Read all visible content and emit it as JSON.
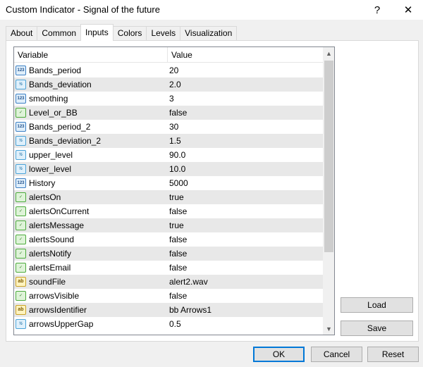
{
  "window": {
    "title": "Custom Indicator - Signal of the future",
    "help_glyph": "?",
    "close_glyph": "✕"
  },
  "tabs": [
    {
      "label": "About"
    },
    {
      "label": "Common"
    },
    {
      "label": "Inputs"
    },
    {
      "label": "Colors"
    },
    {
      "label": "Levels"
    },
    {
      "label": "Visualization"
    }
  ],
  "active_tab": "Inputs",
  "table": {
    "headers": {
      "variable": "Variable",
      "value": "Value"
    },
    "rows": [
      {
        "icon": "int-icon",
        "icon_text": "123",
        "name": "Bands_period",
        "value": "20"
      },
      {
        "icon": "double-icon",
        "icon_text": "½",
        "name": "Bands_deviation",
        "value": "2.0"
      },
      {
        "icon": "int-icon",
        "icon_text": "123",
        "name": "smoothing",
        "value": "3"
      },
      {
        "icon": "bool-icon",
        "icon_text": "✓",
        "name": "Level_or_BB",
        "value": "false"
      },
      {
        "icon": "int-icon",
        "icon_text": "123",
        "name": "Bands_period_2",
        "value": "30"
      },
      {
        "icon": "double-icon",
        "icon_text": "½",
        "name": "Bands_deviation_2",
        "value": "1.5"
      },
      {
        "icon": "double-icon",
        "icon_text": "½",
        "name": "upper_level",
        "value": "90.0"
      },
      {
        "icon": "double-icon",
        "icon_text": "½",
        "name": "lower_level",
        "value": "10.0"
      },
      {
        "icon": "int-icon",
        "icon_text": "123",
        "name": "History",
        "value": "5000"
      },
      {
        "icon": "bool-icon",
        "icon_text": "✓",
        "name": "alertsOn",
        "value": "true"
      },
      {
        "icon": "bool-icon",
        "icon_text": "✓",
        "name": "alertsOnCurrent",
        "value": "false"
      },
      {
        "icon": "bool-icon",
        "icon_text": "✓",
        "name": "alertsMessage",
        "value": "true"
      },
      {
        "icon": "bool-icon",
        "icon_text": "✓",
        "name": "alertsSound",
        "value": "false"
      },
      {
        "icon": "bool-icon",
        "icon_text": "✓",
        "name": "alertsNotify",
        "value": "false"
      },
      {
        "icon": "bool-icon",
        "icon_text": "✓",
        "name": "alertsEmail",
        "value": "false"
      },
      {
        "icon": "string-icon",
        "icon_text": "ab",
        "name": "soundFile",
        "value": "alert2.wav"
      },
      {
        "icon": "bool-icon",
        "icon_text": "✓",
        "name": "arrowsVisible",
        "value": "false"
      },
      {
        "icon": "string-icon",
        "icon_text": "ab",
        "name": "arrowsIdentifier",
        "value": "bb Arrows1"
      },
      {
        "icon": "double-icon",
        "icon_text": "½",
        "name": "arrowsUpperGap",
        "value": "0.5"
      }
    ]
  },
  "side_buttons": {
    "load": "Load",
    "save": "Save"
  },
  "footer_buttons": {
    "ok": "OK",
    "cancel": "Cancel",
    "reset": "Reset"
  },
  "scrollbar": {
    "up_glyph": "▲",
    "down_glyph": "▼"
  }
}
